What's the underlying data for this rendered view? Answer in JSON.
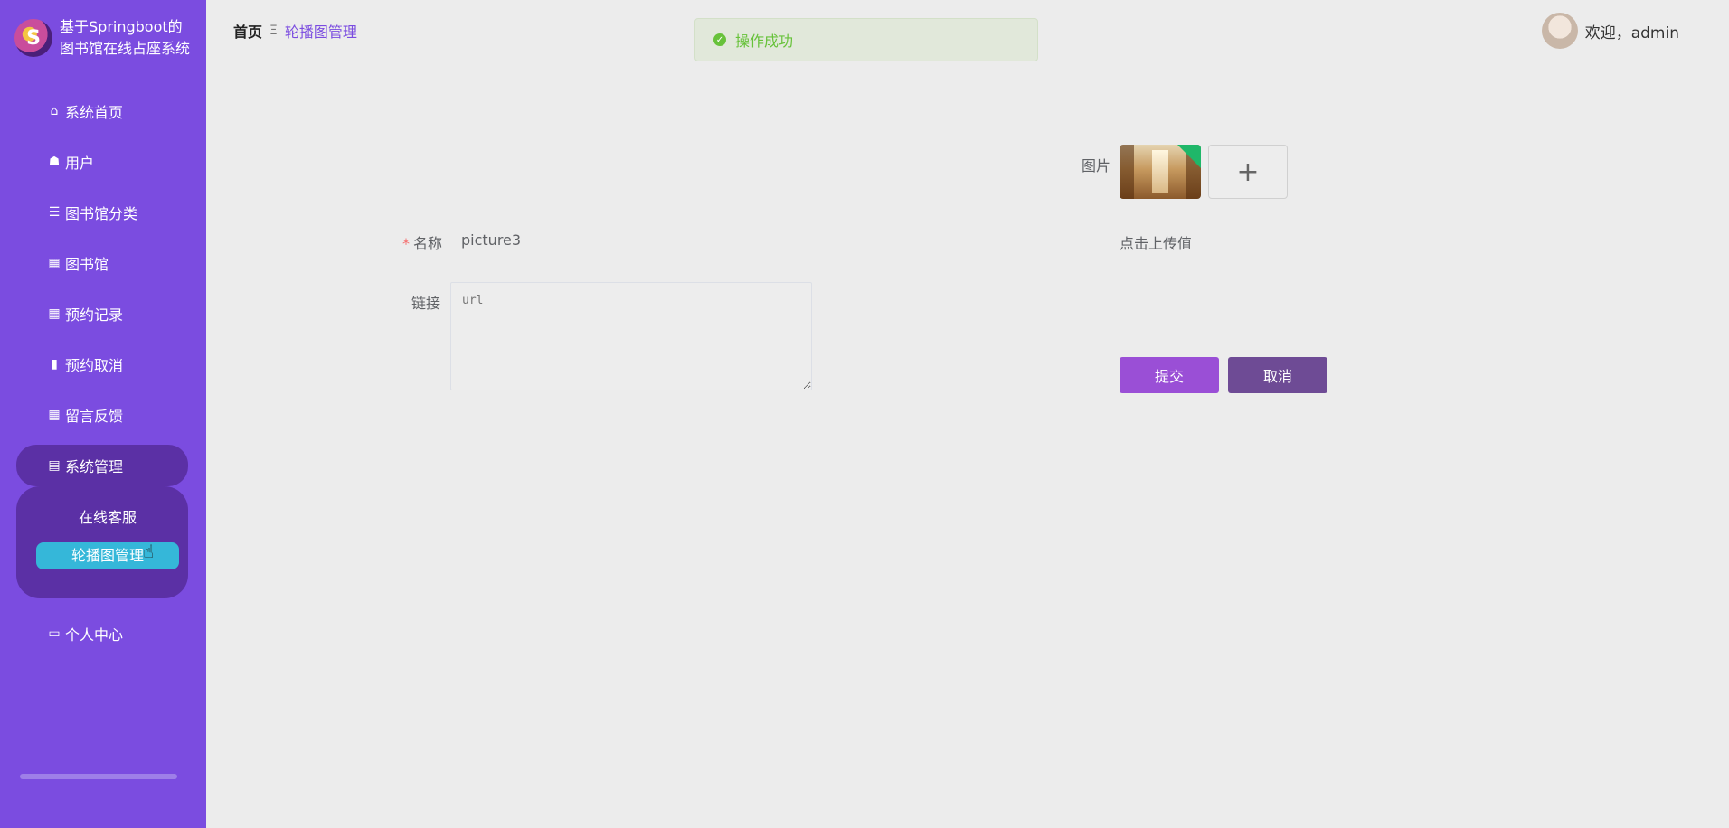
{
  "brand": {
    "logo_glyph": "S",
    "title_line1": "基于Springboot的",
    "title_line2": "图书馆在线占座系统"
  },
  "sidebar": {
    "items": [
      {
        "label": "系统首页",
        "icon": "home-icon",
        "glyph": "⌂"
      },
      {
        "label": "用户",
        "icon": "user-icon",
        "glyph": "☗"
      },
      {
        "label": "图书馆分类",
        "icon": "sliders-icon",
        "glyph": "☰"
      },
      {
        "label": "图书馆",
        "icon": "grid-icon",
        "glyph": "▦"
      },
      {
        "label": "预约记录",
        "icon": "grid-icon",
        "glyph": "▦"
      },
      {
        "label": "预约取消",
        "icon": "bars-icon",
        "glyph": "▮"
      },
      {
        "label": "留言反馈",
        "icon": "grid-icon",
        "glyph": "▦"
      },
      {
        "label": "系统管理",
        "icon": "clipboard-icon",
        "glyph": "▤"
      }
    ],
    "submenu": [
      {
        "label": "在线客服"
      },
      {
        "label": "轮播图管理"
      }
    ],
    "bottom_item": {
      "label": "个人中心",
      "icon": "wallet-icon",
      "glyph": "▭"
    }
  },
  "header": {
    "breadcrumb_home": "首页",
    "breadcrumb_sep": "Ξ",
    "breadcrumb_current": "轮播图管理",
    "toast_text": "操作成功",
    "welcome": "欢迎，admin"
  },
  "form": {
    "picture_label": "图片",
    "upload_plus": "+",
    "upload_hint": "点击上传值",
    "name_label": "名称",
    "name_required_mark": "*",
    "name_value": "picture3",
    "link_label": "链接",
    "link_placeholder": "url",
    "submit_label": "提交",
    "cancel_label": "取消"
  },
  "colors": {
    "sidebar_bg": "#7b4ce0",
    "submenu_bg": "#5b30a5",
    "active_sub": "#35b7d9",
    "submit": "#9a4fd6",
    "cancel": "#6e4b95",
    "success": "#67c23a"
  }
}
